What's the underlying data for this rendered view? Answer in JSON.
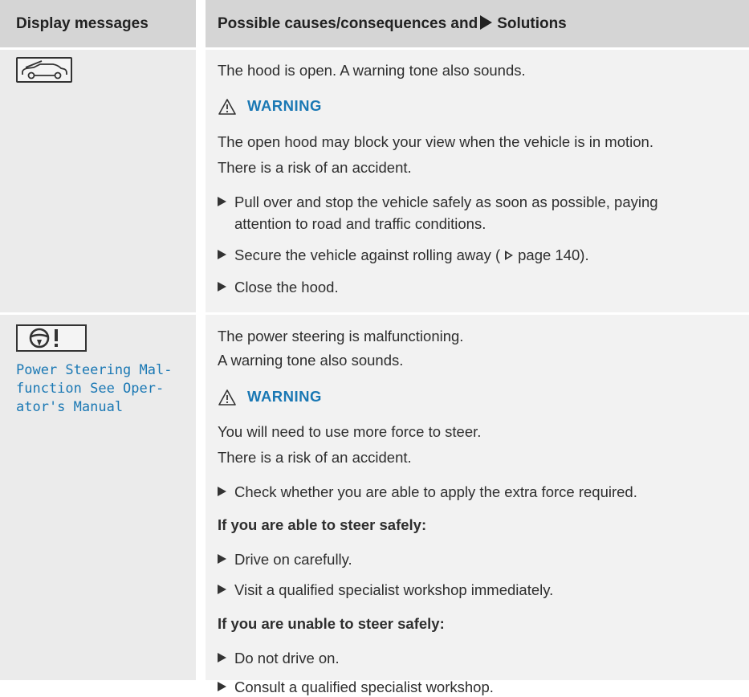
{
  "header": {
    "col1": "Display messages",
    "col2_prefix": "Possible causes/consequences and",
    "col2_suffix": "Solutions"
  },
  "row1": {
    "icon": "hood-open-icon",
    "line1": "The hood is open. A warning tone also sounds.",
    "warning_label": "WARNING",
    "w1": "The open hood may block your view when the vehicle is in motion.",
    "w2": "There is a risk of an accident.",
    "b1a": "Pull over and stop the vehicle safely as soon as possible, paying",
    "b1b": "attention to road and traffic conditions.",
    "b2_prefix": "Secure the vehicle against rolling away (",
    "b2_page": "page 140).",
    "b3": "Close the hood."
  },
  "row2": {
    "icon": "steering-wheel-warning-icon",
    "msg_lines": [
      "Power Steering Mal-",
      "function See Oper-",
      "ator's Manual"
    ],
    "line1": "The power steering is malfunctioning.",
    "line2": "A warning tone also sounds.",
    "warning_label": "WARNING",
    "w1": "You will need to use more force to steer.",
    "w2": "There is a risk of an accident.",
    "b1": "Check whether you are able to apply the extra force required.",
    "h1": "If you are able to steer safely:",
    "b2": "Drive on carefully.",
    "b3": "Visit a qualified specialist workshop immediately.",
    "h2": "If you are unable to steer safely:",
    "b4": "Do not drive on.",
    "b5": "Consult a qualified specialist workshop."
  },
  "colors": {
    "accent": "#1a78b4",
    "header_bg": "#d5d5d5",
    "cell_bg": "#f2f2f2",
    "left_bg": "#ebebeb"
  }
}
